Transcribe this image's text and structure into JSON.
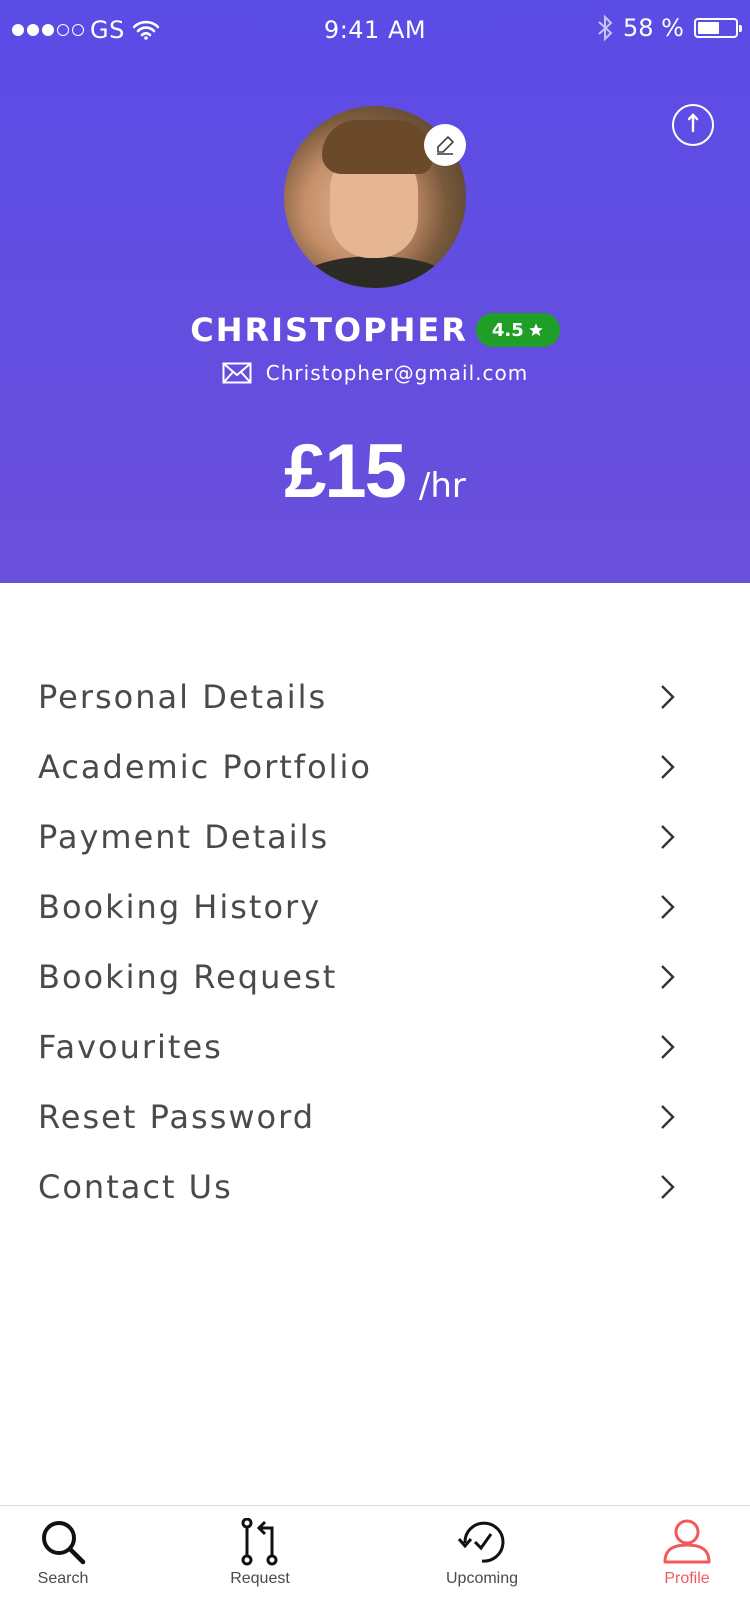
{
  "status_bar": {
    "carrier": "GS",
    "time": "9:41 AM",
    "battery_text": "58 %",
    "battery_level": 0.58
  },
  "profile": {
    "name": "CHRISTOPHER",
    "rating": "4.5",
    "email": "Christopher@gmail.com",
    "rate_value": "£15",
    "rate_unit": "/hr"
  },
  "menu": {
    "items": [
      {
        "label": "Personal Details"
      },
      {
        "label": "Academic Portfolio"
      },
      {
        "label": "Payment Details"
      },
      {
        "label": "Booking History"
      },
      {
        "label": "Booking Request"
      },
      {
        "label": "Favourites"
      },
      {
        "label": "Reset Password"
      },
      {
        "label": "Contact Us"
      }
    ]
  },
  "tabbar": {
    "tabs": [
      {
        "label": "Search",
        "icon": "search-icon"
      },
      {
        "label": "Request",
        "icon": "request-icon"
      },
      {
        "label": "Upcoming",
        "icon": "upcoming-icon"
      },
      {
        "label": "Profile",
        "icon": "profile-icon"
      }
    ],
    "active": "Profile"
  },
  "colors": {
    "header_start": "#5b4ce6",
    "header_end": "#6a4fdb",
    "rating_badge": "#1f9f28",
    "active_tab": "#f25a5a",
    "menu_text": "#4a4a4a"
  }
}
